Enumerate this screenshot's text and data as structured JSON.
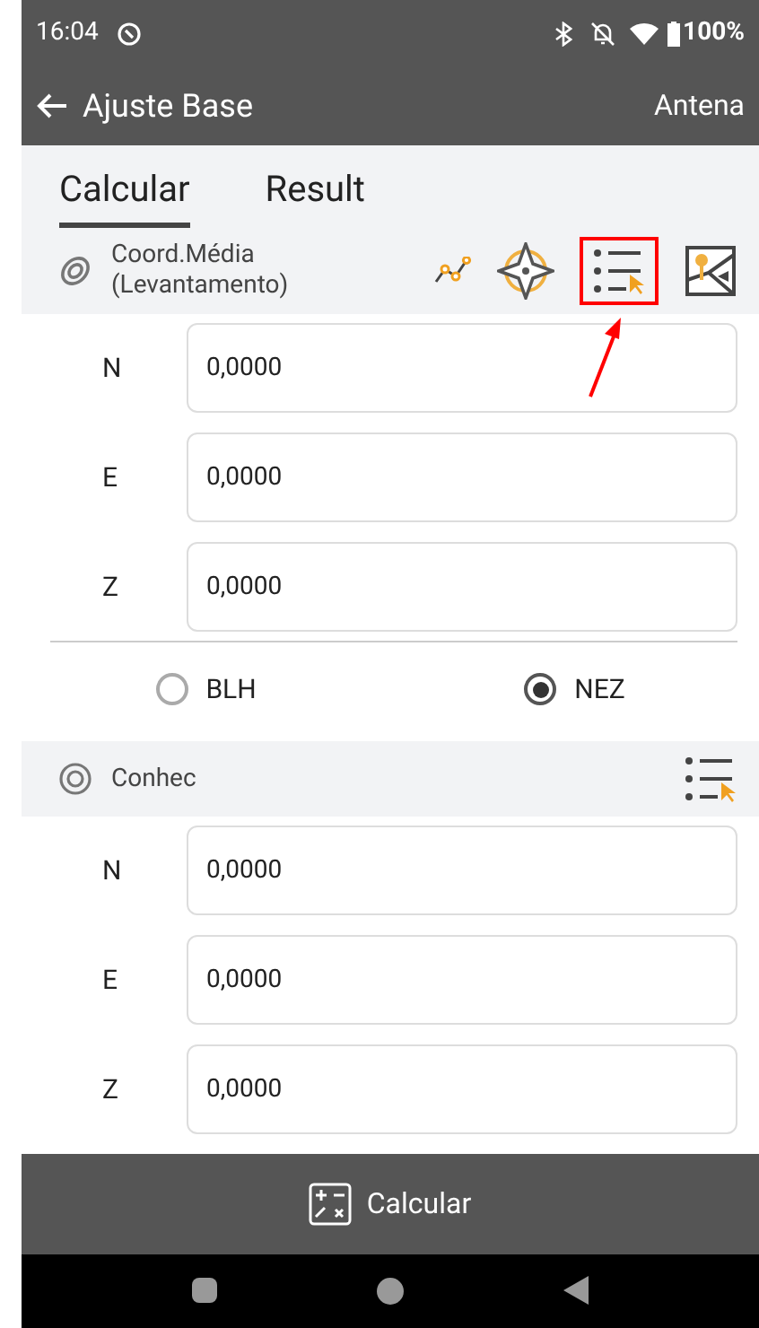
{
  "status_bar": {
    "time": "16:04",
    "battery": "100%"
  },
  "app_bar": {
    "title": "Ajuste Base",
    "action": "Antena"
  },
  "tabs": [
    {
      "label": "Calcular",
      "selected": true
    },
    {
      "label": "Result",
      "selected": false
    }
  ],
  "sections": [
    {
      "title": "Coord.Média\n(Levantamento)",
      "kind": "survey",
      "fields": [
        {
          "label": "N",
          "value": "0,0000"
        },
        {
          "label": "E",
          "value": "0,0000"
        },
        {
          "label": "Z",
          "value": "0,0000"
        }
      ],
      "options": [
        {
          "label": "BLH",
          "selected": false
        },
        {
          "label": "NEZ",
          "selected": true
        }
      ]
    },
    {
      "title": "Conhec",
      "kind": "known",
      "fields": [
        {
          "label": "N",
          "value": "0,0000"
        },
        {
          "label": "E",
          "value": "0,0000"
        },
        {
          "label": "Z",
          "value": "0,0000"
        }
      ]
    }
  ],
  "bottom_button": "Calcular"
}
